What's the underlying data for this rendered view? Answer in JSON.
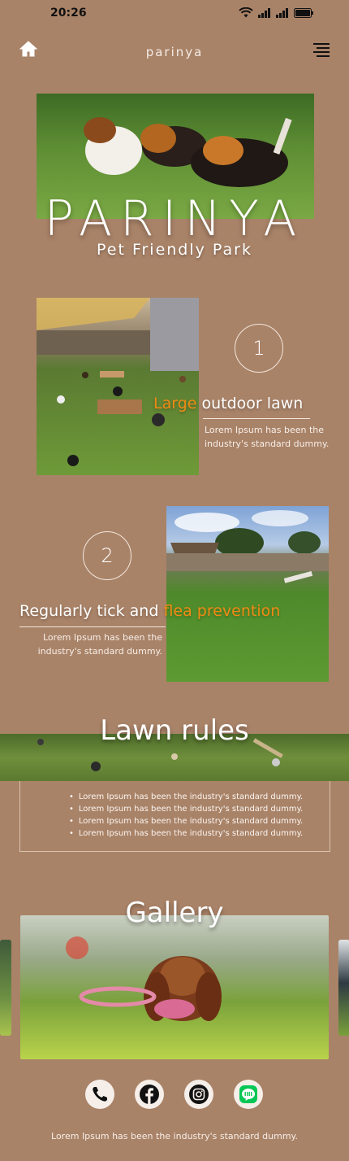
{
  "status_bar": {
    "time": "20:26"
  },
  "header": {
    "brand": "parinya"
  },
  "hero": {
    "title": "PARINYA",
    "subtitle": "Pet Friendly Park"
  },
  "features": [
    {
      "number": "1",
      "title_accent": "Large",
      "title_rest": " outdoor lawn",
      "description": "Lorem Ipsum has been the industry's standard dummy."
    },
    {
      "number": "2",
      "title_rest": "Regularly tick and ",
      "title_accent": "flea prevention",
      "description": "Lorem Ipsum has been the industry's standard dummy."
    }
  ],
  "rules": {
    "title": "Lawn rules",
    "items": [
      "Lorem Ipsum has been the industry's standard dummy.",
      "Lorem Ipsum has been the industry's standard dummy.",
      "Lorem Ipsum has been the industry's standard dummy.",
      "Lorem Ipsum has been the industry's standard dummy."
    ]
  },
  "gallery": {
    "title": "Gallery"
  },
  "social": [
    "phone-icon",
    "facebook-icon",
    "instagram-icon",
    "line-icon"
  ],
  "footer": {
    "text": "Lorem Ipsum has been the industry's standard dummy."
  },
  "colors": {
    "background": "#a98368",
    "accent": "#f08a14",
    "line_brand": "#06c755"
  }
}
